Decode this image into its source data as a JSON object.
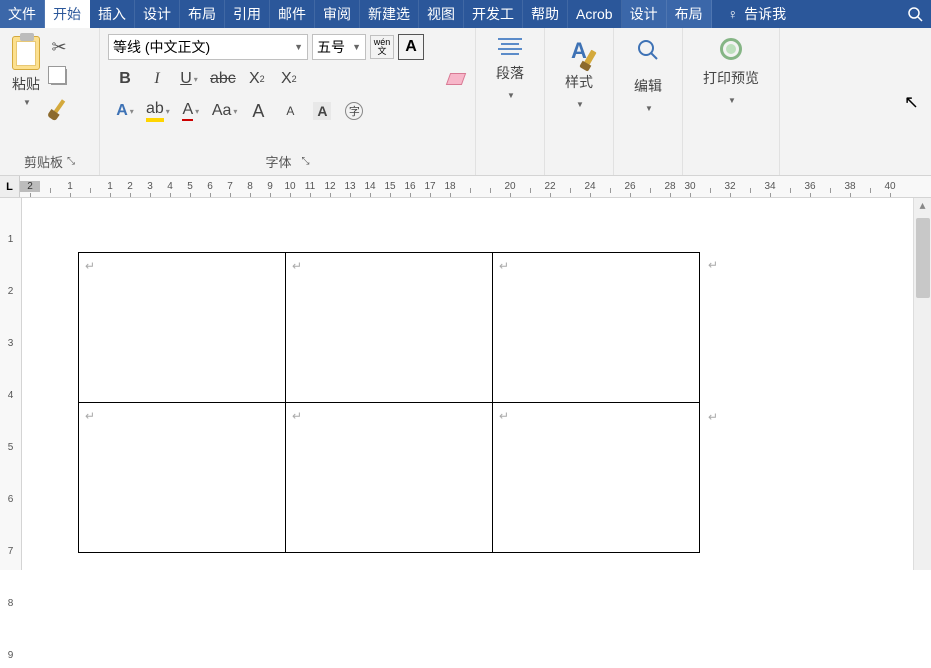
{
  "tabs": {
    "file": "文件",
    "home": "开始",
    "insert": "插入",
    "design": "设计",
    "layout": "布局",
    "references": "引用",
    "mailings": "邮件",
    "review": "审阅",
    "newtab": "新建选",
    "view": "视图",
    "developer": "开发工",
    "help": "帮助",
    "acrobat": "Acrob",
    "design2": "设计",
    "layout2": "布局"
  },
  "tell_me": "告诉我",
  "clipboard": {
    "paste": "粘贴",
    "group": "剪贴板"
  },
  "font": {
    "name": "等线 (中文正文)",
    "size": "五号",
    "wen_top": "wén",
    "wen_bot": "文",
    "boxA": "A",
    "bold": "B",
    "italic": "I",
    "underline": "U",
    "strike": "abc",
    "sub": "X",
    "sub2": "2",
    "sup": "X",
    "sup2": "2",
    "outlineA": "A",
    "hlA": "ab",
    "colorA": "A",
    "caseAa": "Aa",
    "growA": "A",
    "shrinkA": "A",
    "shadeA": "A",
    "circled": "字",
    "group": "字体"
  },
  "groups": {
    "paragraph": "段落",
    "styles": "样式",
    "editing": "编辑",
    "preview": "打印预览"
  },
  "styleA": "A",
  "ruler": {
    "L": "L",
    "h": [
      "2",
      "",
      "1",
      "",
      "1",
      "2",
      "3",
      "4",
      "5",
      "6",
      "7",
      "8",
      "9",
      "10",
      "11",
      "12",
      "13",
      "14",
      "15",
      "16",
      "17",
      "18",
      "",
      "",
      "20",
      "",
      "22",
      "",
      "24",
      "",
      "26",
      "",
      "28",
      "30",
      "",
      "32",
      "",
      "34",
      "",
      "36",
      "",
      "38",
      "",
      "40"
    ],
    "v_top": "—",
    "v": [
      "",
      "1",
      "",
      "2",
      "",
      "3",
      "",
      "4",
      "",
      "5",
      "",
      "6",
      "",
      "7",
      "",
      "8",
      "",
      "9"
    ]
  },
  "para_mark": "↵"
}
